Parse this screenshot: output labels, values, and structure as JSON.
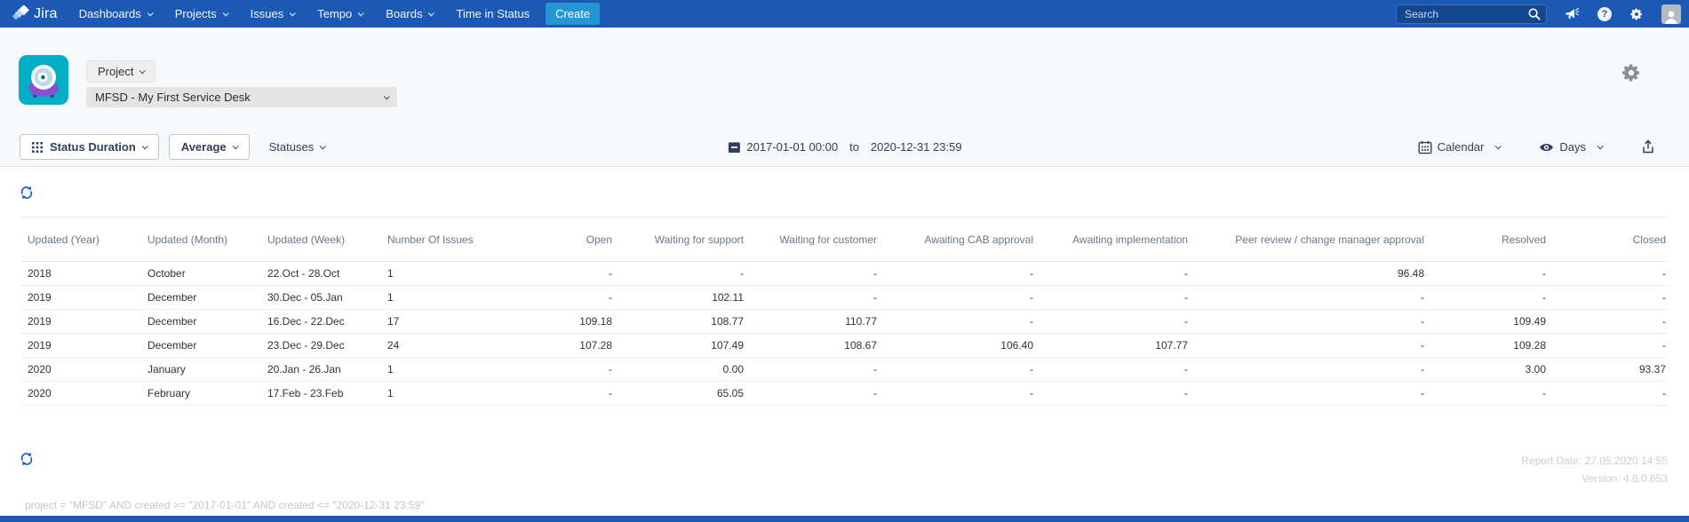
{
  "navbar": {
    "logo": "Jira",
    "items": [
      {
        "label": "Dashboards",
        "chevron": true
      },
      {
        "label": "Projects",
        "chevron": true
      },
      {
        "label": "Issues",
        "chevron": true
      },
      {
        "label": "Tempo",
        "chevron": true
      },
      {
        "label": "Boards",
        "chevron": true
      },
      {
        "label": "Time in Status",
        "chevron": false
      }
    ],
    "create_label": "Create",
    "search_placeholder": "Search",
    "icons": [
      "search-icon",
      "megaphone-icon",
      "help-icon",
      "gear-icon",
      "user-avatar"
    ]
  },
  "header": {
    "project_button_label": "Project",
    "project_select_value": "MFSD - My First Service Desk",
    "icons": [
      "project-avatar",
      "settings-gear-icon"
    ]
  },
  "toolbar": {
    "report_type_label": "Status Duration",
    "aggregation_label": "Average",
    "statuses_label": "Statuses",
    "date_from": "2017-01-01 00:00",
    "date_to_word": "to",
    "date_to": "2020-12-31 23:59",
    "calendar_label": "Calendar",
    "unit_label": "Days",
    "icons": [
      "grid-icon",
      "calendar-icon",
      "eye-icon",
      "export-icon"
    ]
  },
  "table": {
    "columns": [
      "Updated (Year)",
      "Updated (Month)",
      "Updated (Week)",
      "Number Of Issues",
      "Open",
      "Waiting for support",
      "Waiting for customer",
      "Awaiting CAB approval",
      "Awaiting implementation",
      "Peer review / change manager approval",
      "Resolved",
      "Closed"
    ],
    "rows": [
      [
        "2018",
        "October",
        "22.Oct - 28.Oct",
        "1",
        "-",
        "-",
        "-",
        "-",
        "-",
        "96.48",
        "-",
        "-"
      ],
      [
        "2019",
        "December",
        "30.Dec - 05.Jan",
        "1",
        "-",
        "102.11",
        "-",
        "-",
        "-",
        "-",
        "-",
        "-"
      ],
      [
        "2019",
        "December",
        "16.Dec - 22.Dec",
        "17",
        "109.18",
        "108.77",
        "110.77",
        "-",
        "-",
        "-",
        "109.49",
        "-"
      ],
      [
        "2019",
        "December",
        "23.Dec - 29.Dec",
        "24",
        "107.28",
        "107.49",
        "108.67",
        "106.40",
        "107.77",
        "-",
        "109.28",
        "-"
      ],
      [
        "2020",
        "January",
        "20.Jan - 26.Jan",
        "1",
        "-",
        "0.00",
        "-",
        "-",
        "-",
        "-",
        "3.00",
        "93.37"
      ],
      [
        "2020",
        "February",
        "17.Feb - 23.Feb",
        "1",
        "-",
        "65.05",
        "-",
        "-",
        "-",
        "-",
        "-",
        "-"
      ]
    ]
  },
  "footer": {
    "report_date": "Report Date: 27.05.2020 14:55",
    "version": "Version: 4.8.0.653",
    "jql": "project = \"MFSD\" AND created >= \"2017-01-01\" AND created <= \"2020-12-31 23:59\"",
    "icons": [
      "refresh-icon"
    ]
  },
  "colors": {
    "navbar_bg": "#1c59b5",
    "create_button_bg": "#2596d4",
    "refresh_blue": "#1f5de0",
    "project_avatar_teal": "#00aec6",
    "project_avatar_purple": "#8a4fd0",
    "toolbar_text": "#32405c",
    "table_header_text": "#68778c",
    "muted_footer_text": "#c9cdd4"
  }
}
